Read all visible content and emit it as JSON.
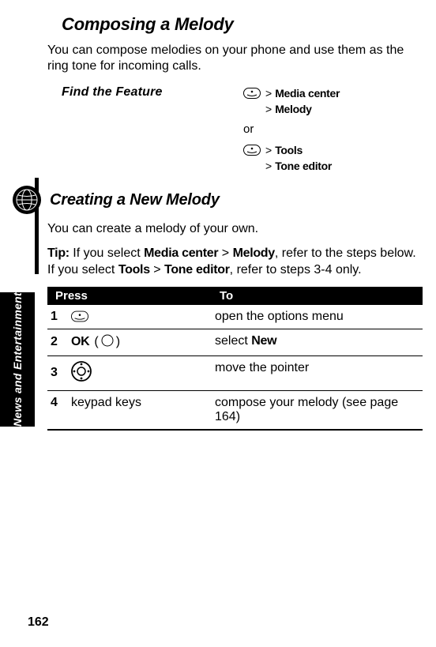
{
  "sidebar": {
    "label": "News and Entertainment"
  },
  "heading": "Composing a Melody",
  "intro": "You can compose melodies on your phone and use them as the ring tone for incoming calls.",
  "feature": {
    "label": "Find the Feature",
    "nav1": {
      "line1a": ">",
      "line1b": "Media center",
      "line2a": ">",
      "line2b": "Melody"
    },
    "or": "or",
    "nav2": {
      "line1a": ">",
      "line1b": "Tools",
      "line2a": ">",
      "line2b": "Tone editor"
    }
  },
  "subheading": "Creating a New Melody",
  "subintro": "You can create a melody of your own.",
  "tip": {
    "label": "Tip:",
    "before": " If you select ",
    "path1": "Media center",
    "sep": " > ",
    "path1b": "Melody",
    "mid": ", refer to the steps below. If you select ",
    "path2": "Tools",
    "path2b": "Tone editor",
    "after": ", refer to steps 3-4 only."
  },
  "table": {
    "headers": {
      "press": "Press",
      "to": "To"
    },
    "rows": [
      {
        "num": "1",
        "press_text": "",
        "to": "open the options menu"
      },
      {
        "num": "2",
        "press_text_prefix": "OK",
        "press_text_suffix": "(        )",
        "to_prefix": "select ",
        "to_bold": "New"
      },
      {
        "num": "3",
        "press_text": "",
        "to": "move the pointer"
      },
      {
        "num": "4",
        "press_text": "keypad keys",
        "to": "compose your melody  (see page 164)"
      }
    ]
  },
  "page_number": "162"
}
